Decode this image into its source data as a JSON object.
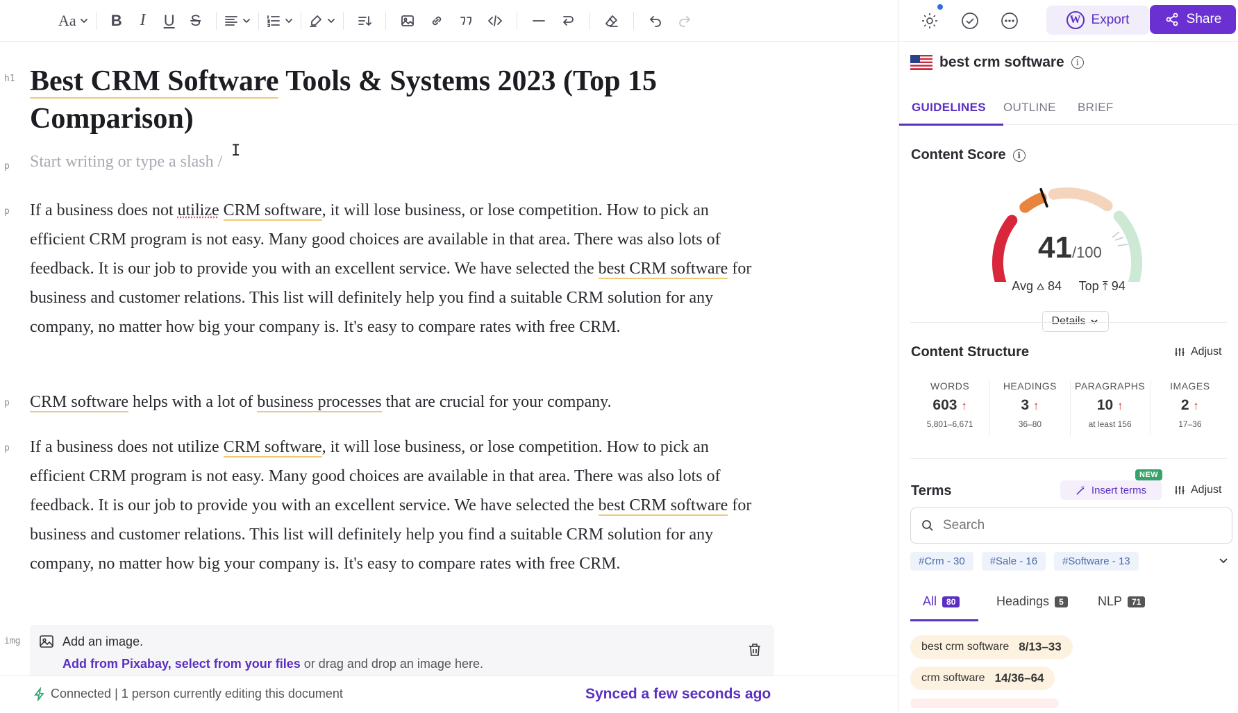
{
  "toolbar": {
    "font_label": "Aa",
    "bold_label": "B",
    "italic_label": "I",
    "underline_label": "U",
    "strike_label": "S",
    "icons": [
      "font-size-icon",
      "bold-icon",
      "italic-icon",
      "underline-icon",
      "strikethrough-icon",
      "align-icon",
      "list-icon",
      "highlighter-icon",
      "sort-icon",
      "image-icon",
      "link-icon",
      "quote-icon",
      "code-icon",
      "divider-icon",
      "line-break-icon",
      "eraser-icon",
      "undo-icon",
      "redo-icon"
    ]
  },
  "editor": {
    "h1_tag": "h1",
    "p_tag": "p",
    "img_tag": "img",
    "title_parts": [
      "Best CRM Software",
      " Tools & Systems 2023 (Top 15 Comparison)"
    ],
    "placeholder": "Start writing or type a slash /",
    "para1": {
      "s1": "If a business does not ",
      "k1": "utilize",
      "s2": " ",
      "k2": "CRM software",
      "s3": ", it will lose business, or lose competition. How to pick an efficient CRM program is not easy. Many good choices are available in that area. There was also lots of feedback. It is our job to provide you with an excellent service. We have selected the ",
      "k3": "best CRM software",
      "s4": " for business and customer relations. This list will definitely help you find a suitable CRM solution for any company, no matter how big your company is. It's easy to compare rates with free CRM."
    },
    "para2": {
      "k1": "CRM software",
      "s1": " helps with a lot of ",
      "k2": "business processes",
      "s2": " that are crucial for your company."
    },
    "para3": {
      "s1": "If a business does not utilize ",
      "k1": "CRM software",
      "s2": ", it will lose business, or lose competition. How to pick an efficient CRM program is not easy. Many good choices are available in that area. There was also lots of feedback. It is our job to provide you with an excellent service. We have selected the ",
      "k2": "best CRM software",
      "s3": " for business and customer relations. This list will definitely help you find a suitable CRM solution for any company, no matter how big your company is. It's easy to compare rates with free CRM."
    },
    "image_block": {
      "title": "Add an image.",
      "link1": "Add from Pixabay",
      "sep": ", ",
      "link2": "select from your files",
      "rest": " or drag and drop an image here."
    }
  },
  "status": {
    "connection": "Connected | 1 person currently editing this document",
    "sync": "Synced a few seconds ago"
  },
  "panel": {
    "export_label": "Export",
    "share_label": "Share",
    "keyword": "best crm software",
    "tabs": [
      "GUIDELINES",
      "OUTLINE",
      "BRIEF"
    ],
    "content_score": {
      "title": "Content Score",
      "score": "41",
      "out_of": "/100",
      "score_value": 41,
      "avg_label": "Avg",
      "avg": "84",
      "top_label": "Top",
      "top": "94",
      "details_label": "Details"
    },
    "structure": {
      "title": "Content Structure",
      "adjust_label": "Adjust",
      "stats": [
        {
          "label": "WORDS",
          "value": "603",
          "range": "5,801–6,671"
        },
        {
          "label": "HEADINGS",
          "value": "3",
          "range": "36–80"
        },
        {
          "label": "PARAGRAPHS",
          "value": "10",
          "range": "at least 156"
        },
        {
          "label": "IMAGES",
          "value": "2",
          "range": "17–36"
        }
      ]
    },
    "terms": {
      "title": "Terms",
      "insert_label": "Insert terms",
      "new_badge": "NEW",
      "adjust_label": "Adjust",
      "search_placeholder": "Search",
      "chips": [
        "#Crm - 30",
        "#Sale - 16",
        "#Software - 13"
      ],
      "filter_tabs": [
        {
          "label": "All",
          "count": "80"
        },
        {
          "label": "Headings",
          "count": "5"
        },
        {
          "label": "NLP",
          "count": "71"
        }
      ],
      "items": [
        {
          "name": "best crm software",
          "count": "8/13–33"
        },
        {
          "name": "crm software",
          "count": "14/36–64"
        }
      ]
    }
  },
  "colors": {
    "brand": "#6a30d1",
    "keyword_underline": "#f0c879",
    "gauge_red": "#d8263b",
    "gauge_orange": "#e8843e",
    "gauge_peach": "#f5d4bd",
    "gauge_green": "#cde9d3"
  }
}
